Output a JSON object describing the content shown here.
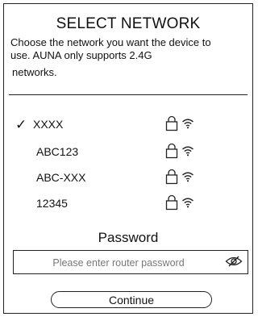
{
  "header": {
    "title": "SELECT NETWORK",
    "subtitle_line1": "Choose the network you want the device to",
    "subtitle_line2": "use. AUNA only supports 2.4G",
    "subtitle_line3": "networks."
  },
  "networks": [
    {
      "name": "XXXX",
      "selected": true,
      "locked": true,
      "icon": "wifi-icon"
    },
    {
      "name": "ABC123",
      "selected": false,
      "locked": true,
      "icon": "wifi-icon"
    },
    {
      "name": "ABC-XXX",
      "selected": false,
      "locked": true,
      "icon": "wifi-icon"
    },
    {
      "name": "12345",
      "selected": false,
      "locked": true,
      "icon": "wifi-icon"
    }
  ],
  "selected_mark": "✓",
  "password": {
    "label": "Password",
    "placeholder": "Please enter router password",
    "value": "",
    "toggle_icon": "eye-hidden-icon"
  },
  "actions": {
    "continue_label": "Continue"
  }
}
